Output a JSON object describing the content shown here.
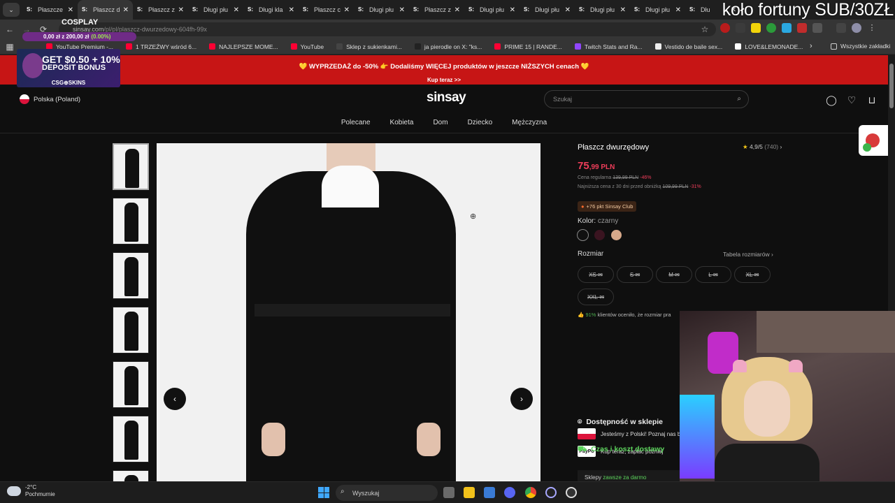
{
  "browser": {
    "tabs": [
      {
        "label": "Płaszcze",
        "favicon": "S:"
      },
      {
        "label": "Płaszcz d",
        "favicon": "S:"
      },
      {
        "label": "Płaszcz z",
        "favicon": "S:"
      },
      {
        "label": "Długi płu",
        "favicon": "S:"
      },
      {
        "label": "Długi kla",
        "favicon": "S:"
      },
      {
        "label": "Płaszcz c",
        "favicon": "S:"
      },
      {
        "label": "Długi płu",
        "favicon": "S:"
      },
      {
        "label": "Płaszcz z",
        "favicon": "S:"
      },
      {
        "label": "Długi płu",
        "favicon": "S:"
      },
      {
        "label": "Długi płu",
        "favicon": "S:"
      },
      {
        "label": "Długi płu",
        "favicon": "S:"
      },
      {
        "label": "Długi płu",
        "favicon": "S:"
      },
      {
        "label": "Dłu",
        "favicon": "S:"
      }
    ],
    "active_tab_index": 1,
    "url_host": "sinsay.com",
    "url_path": "/pl/pl/plaszcz-dwurzedowy-604fh-99x",
    "bookmarks": [
      {
        "label": "YouTube Premium -...",
        "color": "#ff0033"
      },
      {
        "label": "1 TRZEŹWY wśród 6...",
        "color": "#ff0033"
      },
      {
        "label": "NAJLEPSZE MOME...",
        "color": "#ff0033"
      },
      {
        "label": "YouTube",
        "color": "#ff0033"
      },
      {
        "label": "Sklep z sukienkami...",
        "color": "#444444"
      },
      {
        "label": "ja pierodle on X: \"ks...",
        "color": "#222222"
      },
      {
        "label": "PRIME 15 | RANDE...",
        "color": "#ff0033"
      },
      {
        "label": "Twitch Stats and Ra...",
        "color": "#9146ff"
      },
      {
        "label": "Vestido de baile sex...",
        "color": "#eeeeee"
      },
      {
        "label": "LOVE&LEMONADE...",
        "color": "#ffffff"
      }
    ],
    "bookmarks_overflow": "›",
    "all_bookmarks": "Wszystkie zakładki"
  },
  "stream_overlay": {
    "title": "koło fortuny SUB/30ZŁ",
    "goal_title": "COSPLAY",
    "goal_progress": "0,00 zł z 200,00 zł",
    "goal_pct": "(0.00%)",
    "goal_fraction": 0.0,
    "ad_line1": "GET $0.50 + 10%",
    "ad_line2": "DEPOSIT BONUS",
    "ad_brand": "CSG⊕SKINS"
  },
  "store": {
    "promo": "💛 WYPRZEDAŻ do -50% 👉 Dodaliśmy WIĘCEJ produktów w jeszcze NIŻSZYCH cenach 💛",
    "promo_link": "Kup teraz >>",
    "country": "Polska (Poland)",
    "logo": "sinsay",
    "search_placeholder": "Szukaj",
    "nav": [
      "Polecane",
      "Kobieta",
      "Dom",
      "Dziecko",
      "Mężczyzna"
    ]
  },
  "product": {
    "title": "Płaszcz dwurzędowy",
    "rating": "4,9/5",
    "rating_count": "(740)",
    "price_main": "75",
    "price_cents": ",99 PLN",
    "regular_label": "Cena regularna",
    "regular_price": "139,99 PLN",
    "regular_discount": "-46%",
    "lowest_label": "Najniższa cena z 30 dni przed obniżką",
    "lowest_price": "109,99 PLN",
    "lowest_discount": "-31%",
    "club": "+76 pkt Sinsay Club",
    "color_label": "Kolor:",
    "color_value": "czarny",
    "swatches": [
      "#111111",
      "#3a1420",
      "#d7a98a"
    ],
    "size_label": "Rozmiar",
    "size_table": "Tabela rozmiarów",
    "sizes": [
      "XS",
      "S",
      "M",
      "L",
      "XL",
      "XXL"
    ],
    "fit_pct": "91%",
    "fit_text": "klientów oceniło, że rozmiar pra",
    "polish_badge": "Jesteśmy z Polski! Poznaj nas b",
    "paypo_badge": "Kup teraz, zapłać później",
    "paypo_logo": "PayPo",
    "availability": "Dostępność w sklepie",
    "delivery": "Czas i koszt dostawy",
    "stores_label": "Sklepy",
    "stores_value": "zawsze za darmo"
  },
  "taskbar": {
    "temperature": "-2°C",
    "weather": "Pochmurnie",
    "search_placeholder": "Wyszukaj"
  }
}
